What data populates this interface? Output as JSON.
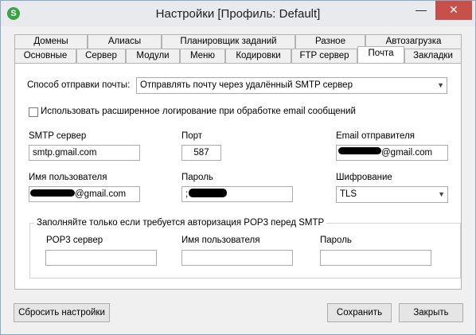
{
  "window": {
    "title": "Настройки [Профиль: Default]",
    "min_glyph": "—",
    "close_glyph": "✕",
    "app_icon": "S"
  },
  "tabs_row1": [
    "Домены",
    "Алиасы",
    "Планировщик заданий",
    "Разное",
    "Автозагрузка"
  ],
  "tabs_row2": [
    "Основные",
    "Сервер",
    "Модули",
    "Меню",
    "Кодировки",
    "FTP сервер",
    "Почта",
    "Закладки"
  ],
  "active_tab": "Почта",
  "send_method": {
    "label": "Способ отправки почты:",
    "value": "Отправлять почту через удалённый SMTP сервер"
  },
  "extended_logging": {
    "label": "Использовать расширенное логирование при обработке email сообщений",
    "checked": false
  },
  "smtp": {
    "label": "SMTP сервер",
    "value": "smtp.gmail.com"
  },
  "port": {
    "label": "Порт",
    "value": "587"
  },
  "sender_email": {
    "label": "Email отправителя",
    "value": "@gmail.com"
  },
  "username": {
    "label": "Имя пользователя",
    "value": "@gmail.com"
  },
  "password": {
    "label": "Пароль",
    "value": ";"
  },
  "encryption": {
    "label": "Шифрование",
    "value": "TLS"
  },
  "pop3": {
    "legend": "Заполняйте только если требуется авторизация POP3 перед SMTP",
    "server_label": "POP3 сервер",
    "user_label": "Имя пользователя",
    "password_label": "Пароль"
  },
  "buttons": {
    "reset": "Сбросить настройки",
    "save": "Сохранить",
    "close": "Закрыть"
  },
  "colors": {
    "close_button": "#c7504a",
    "app_icon": "#3aa345",
    "window_border": "#8aa9c6"
  },
  "icons": {
    "app": "app-logo-icon",
    "dropdown": "chevron-down-icon"
  }
}
